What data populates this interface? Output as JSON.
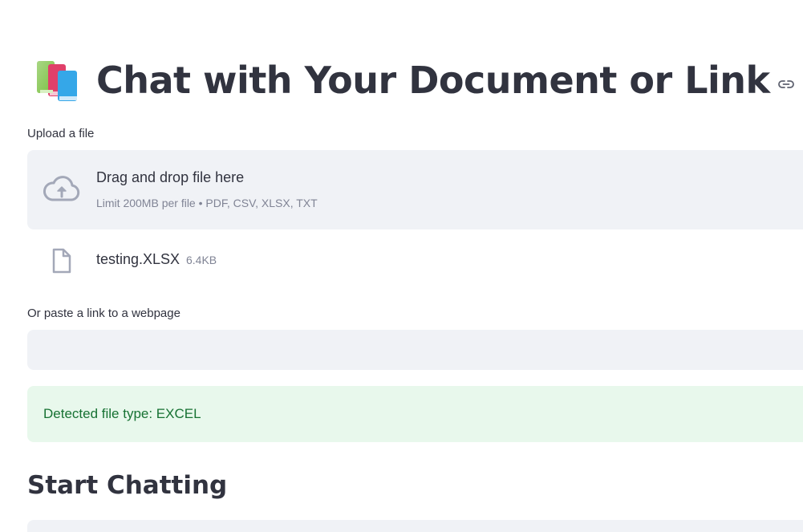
{
  "page": {
    "title": "Chat with Your Document or Link",
    "title_emoji": "books-emoji",
    "anchor_icon": "link-icon"
  },
  "upload": {
    "label": "Upload a file",
    "dropzone_title": "Drag and drop file here",
    "dropzone_subtitle": "Limit 200MB per file • PDF, CSV, XLSX, TXT",
    "icon": "cloud-upload-icon"
  },
  "uploaded_file": {
    "name": "testing.XLSX",
    "size": "6.4KB",
    "icon": "file-icon"
  },
  "link_input": {
    "label": "Or paste a link to a webpage",
    "value": ""
  },
  "alert": {
    "text": "Detected file type: EXCEL"
  },
  "chat": {
    "heading": "Start Chatting"
  },
  "colors": {
    "text": "#31333f",
    "muted": "#808495",
    "input_bg": "#f0f2f6",
    "success_bg": "#e8f8ec",
    "success_text": "#177233"
  }
}
